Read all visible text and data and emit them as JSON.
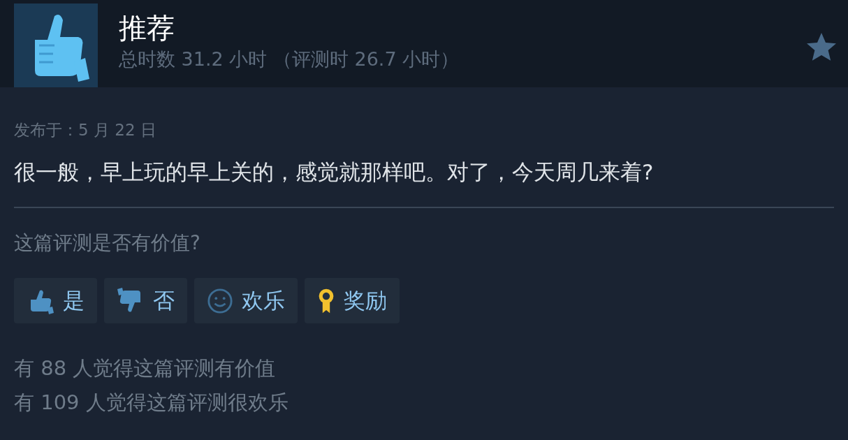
{
  "header": {
    "title": "推荐",
    "playtime": "总时数 31.2 小时 （评测时 26.7 小时）",
    "recommended": true
  },
  "review": {
    "posted": "发布于：5 月 22 日",
    "text": "很一般，早上玩的早上关的，感觉就那样吧。对了，今天周几来着?"
  },
  "rating": {
    "question": "这篇评测是否有价值?",
    "buttons": [
      {
        "kind": "yes",
        "label": "是"
      },
      {
        "kind": "no",
        "label": "否"
      },
      {
        "kind": "funny",
        "label": "欢乐"
      },
      {
        "kind": "award",
        "label": "奖励"
      }
    ],
    "counts": [
      "有 88 人觉得这篇评测有价值",
      "有 109 人觉得这篇评测很欢乐"
    ]
  }
}
